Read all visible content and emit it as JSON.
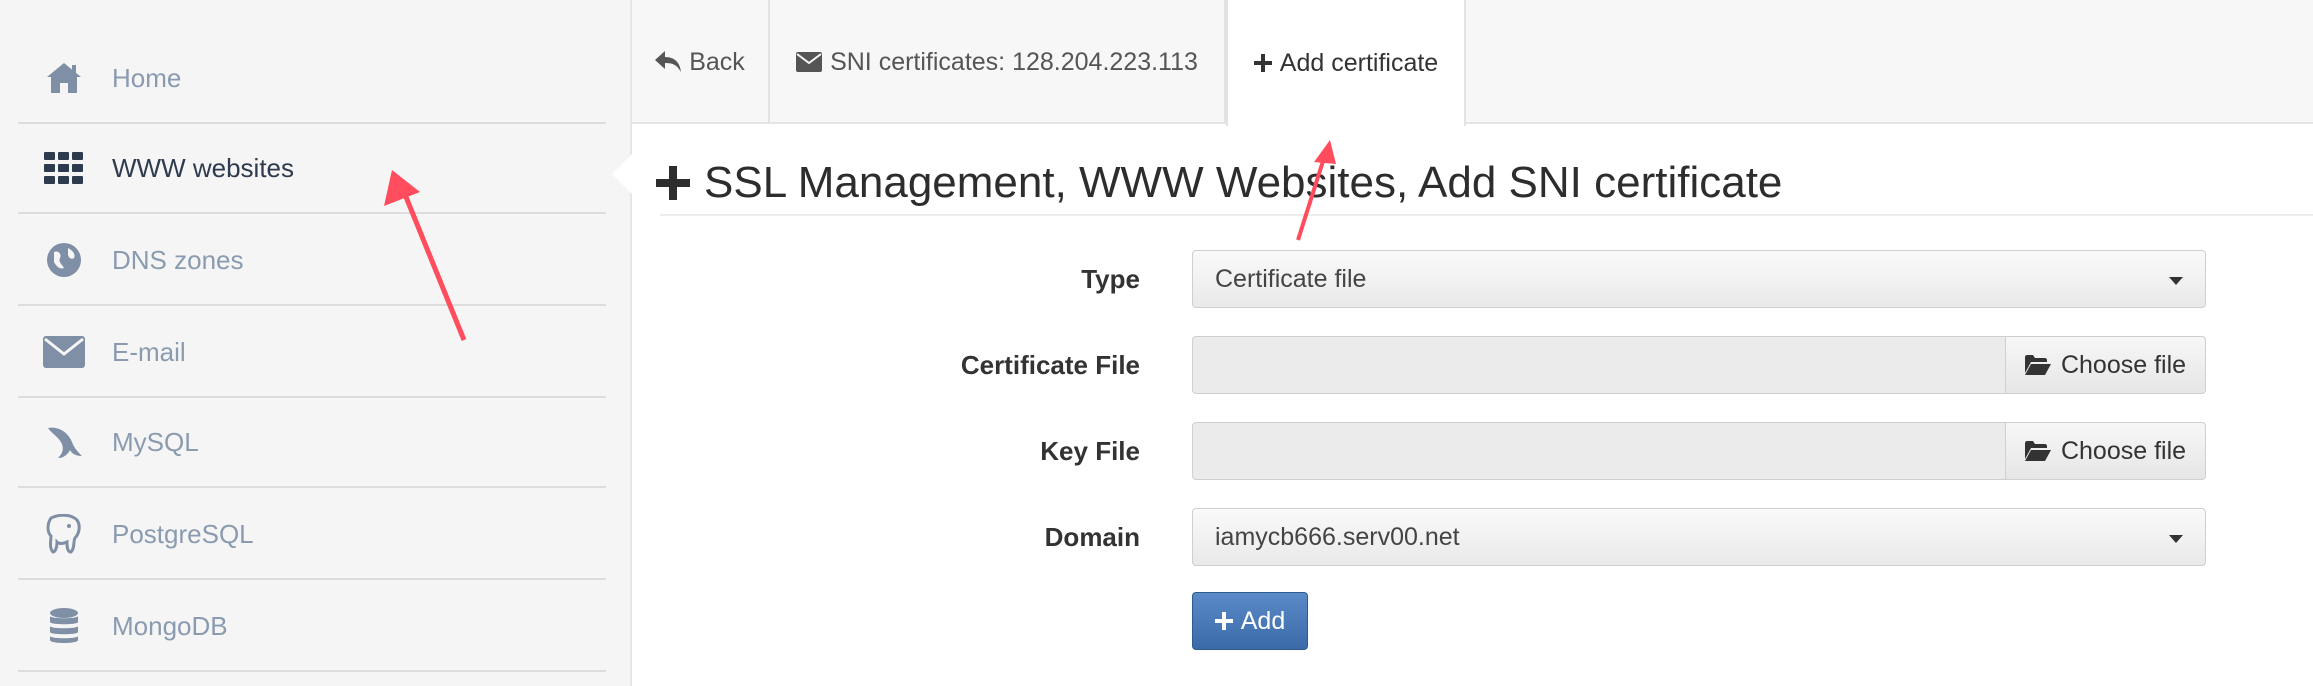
{
  "sidebar": {
    "items": [
      {
        "label": "Home",
        "icon": "home-icon"
      },
      {
        "label": "WWW websites",
        "icon": "grid-icon",
        "active": true
      },
      {
        "label": "DNS zones",
        "icon": "globe-icon"
      },
      {
        "label": "E-mail",
        "icon": "envelope-icon"
      },
      {
        "label": "MySQL",
        "icon": "dolphin-icon"
      },
      {
        "label": "PostgreSQL",
        "icon": "elephant-icon"
      },
      {
        "label": "MongoDB",
        "icon": "database-icon"
      }
    ]
  },
  "tabs": {
    "back": "Back",
    "sni": "SNI certificates: 128.204.223.113",
    "add": "Add certificate"
  },
  "page": {
    "title": "SSL Management, WWW Websites, Add SNI certificate"
  },
  "form": {
    "type_label": "Type",
    "type_value": "Certificate file",
    "cert_label": "Certificate File",
    "cert_button": "Choose file",
    "key_label": "Key File",
    "key_button": "Choose file",
    "domain_label": "Domain",
    "domain_value": "iamycb666.serv00.net",
    "submit": "Add"
  },
  "colors": {
    "sidebar_bg": "#f5f5f5",
    "sidebar_icon": "#7f8fa6",
    "primary_button": "#4a7bbb",
    "annotation_arrow": "#ff4d5e"
  }
}
